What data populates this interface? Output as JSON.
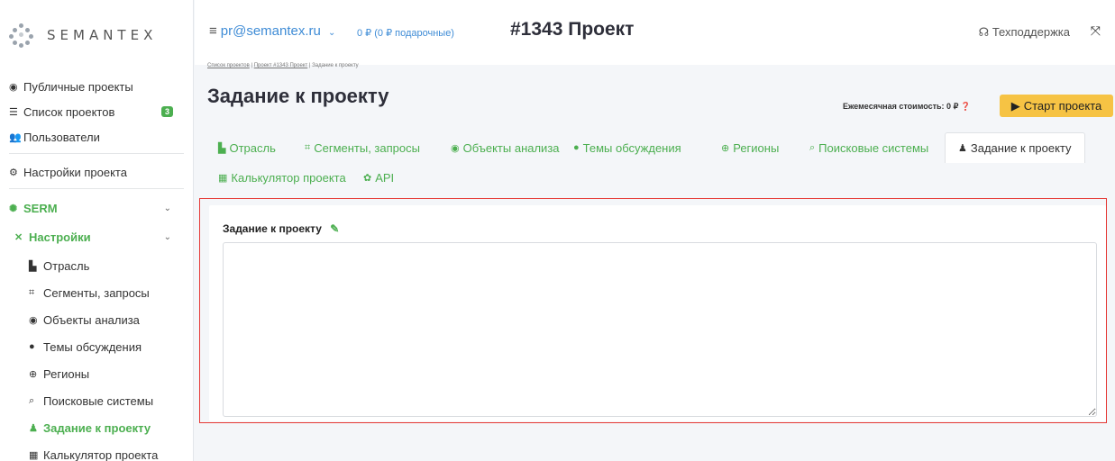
{
  "brand": {
    "name": "SEMANTEX"
  },
  "sidebar": {
    "top_items": [
      {
        "label": "Публичные проекты",
        "icon": "eye-icon"
      },
      {
        "label": "Список проектов",
        "icon": "list-icon",
        "badge": "3"
      },
      {
        "label": "Пользователи",
        "icon": "users-icon"
      },
      {
        "label": "Настройки проекта",
        "icon": "cogs-icon"
      }
    ],
    "serm": {
      "label": "SERM"
    },
    "settings": {
      "label": "Настройки"
    },
    "sub_items": [
      {
        "label": "Отрасль"
      },
      {
        "label": "Сегменты, запросы"
      },
      {
        "label": "Объекты анализа"
      },
      {
        "label": "Темы обсуждения"
      },
      {
        "label": "Регионы"
      },
      {
        "label": "Поисковые системы"
      },
      {
        "label": "Задание к проекту"
      },
      {
        "label": "Калькулятор проекта"
      }
    ]
  },
  "topbar": {
    "email": "pr@semantex.ru",
    "balance": "0 ₽ (0 ₽ подарочные)",
    "project_title": "#1343 Проект",
    "support": "Техподдержка"
  },
  "breadcrumb": {
    "items": [
      "Список проектов",
      "Проект #1343 Проект",
      "Задание к проекту"
    ]
  },
  "page": {
    "heading": "Задание к проекту",
    "monthly_cost": "Ежемесячная стоимость: 0 ₽",
    "start_button": "Старт проекта"
  },
  "tabs": [
    {
      "label": "Отрасль"
    },
    {
      "label": "Сегменты, запросы"
    },
    {
      "label": "Объекты анализа"
    },
    {
      "label": "Темы обсуждения"
    },
    {
      "label": "Регионы"
    },
    {
      "label": "Поисковые системы"
    },
    {
      "label": "Задание к проекту"
    },
    {
      "label": "Калькулятор проекта"
    },
    {
      "label": "API"
    }
  ],
  "card": {
    "label": "Задание к проекту",
    "textarea_value": ""
  },
  "colors": {
    "accent": "#4caf50",
    "link": "#3f8cd6",
    "button": "#f6c344",
    "highlight": "#e53935"
  }
}
